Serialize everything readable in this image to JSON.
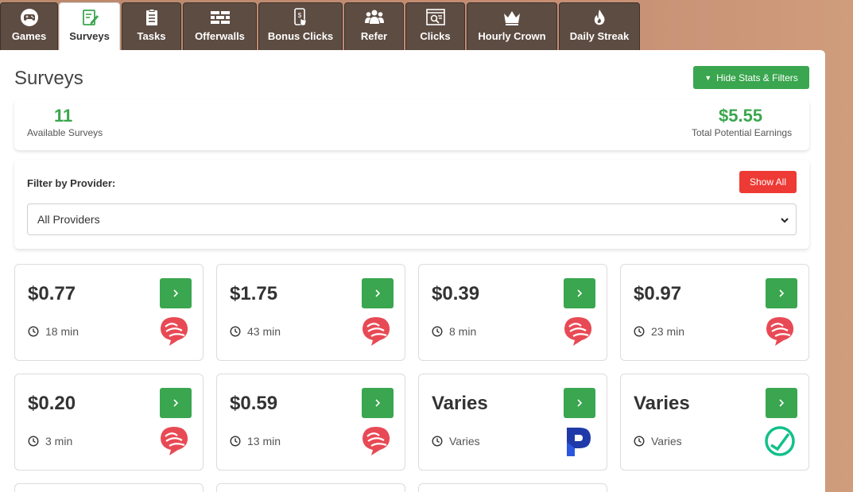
{
  "tabs": [
    {
      "label": "Games",
      "icon": "gamepad-icon",
      "active": false
    },
    {
      "label": "Surveys",
      "icon": "survey-icon",
      "active": true
    },
    {
      "label": "Tasks",
      "icon": "clipboard-icon",
      "active": false
    },
    {
      "label": "Offerwalls",
      "icon": "brick-wall-icon",
      "active": false
    },
    {
      "label": "Bonus Clicks",
      "icon": "tap-icon",
      "active": false
    },
    {
      "label": "Refer",
      "icon": "users-icon",
      "active": false
    },
    {
      "label": "Clicks",
      "icon": "browser-search-icon",
      "active": false
    },
    {
      "label": "Hourly Crown",
      "icon": "crown-icon",
      "active": false
    },
    {
      "label": "Daily Streak",
      "icon": "flame-icon",
      "active": false
    }
  ],
  "page": {
    "title": "Surveys",
    "hide_button": "Hide Stats & Filters"
  },
  "stats": {
    "available_count": "11",
    "available_label": "Available Surveys",
    "earnings": "$5.55",
    "earnings_label": "Total Potential Earnings"
  },
  "filter": {
    "label": "Filter by Provider:",
    "show_all": "Show All",
    "selected": "All Providers"
  },
  "surveys": [
    {
      "amount": "$0.77",
      "time": "18 min",
      "provider": "red-bubble-logo"
    },
    {
      "amount": "$1.75",
      "time": "43 min",
      "provider": "red-bubble-logo"
    },
    {
      "amount": "$0.39",
      "time": "8 min",
      "provider": "red-bubble-logo"
    },
    {
      "amount": "$0.97",
      "time": "23 min",
      "provider": "red-bubble-logo"
    },
    {
      "amount": "$0.20",
      "time": "3 min",
      "provider": "red-bubble-logo"
    },
    {
      "amount": "$0.59",
      "time": "13 min",
      "provider": "red-bubble-logo"
    },
    {
      "amount": "Varies",
      "time": "Varies",
      "provider": "blue-p-logo"
    },
    {
      "amount": "Varies",
      "time": "Varies",
      "provider": "green-check-circle-logo"
    }
  ],
  "colors": {
    "brand_green": "#3aa64f",
    "danger_red": "#ee3a35",
    "tab_brown": "#5d4c42",
    "provider_red": "#e84a55",
    "provider_blue": "#1f3aa8",
    "provider_teal": "#12c08a"
  }
}
